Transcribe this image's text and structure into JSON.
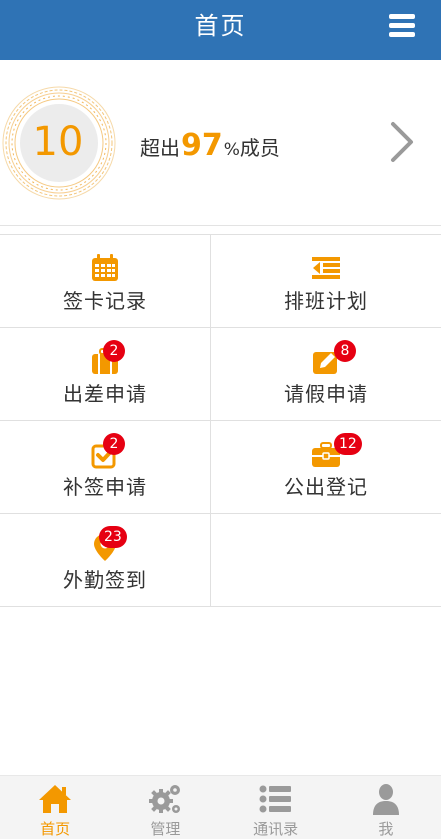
{
  "header": {
    "title": "首页",
    "menu_icon": "hamburger-menu-icon"
  },
  "score": {
    "value": "10",
    "prefix": "超出",
    "percent": "97",
    "unit": "%",
    "suffix": "成员",
    "arrow_icon": "chevron-right-icon"
  },
  "grid": [
    {
      "label": "签卡记录",
      "icon": "calendar-icon",
      "badge": ""
    },
    {
      "label": "排班计划",
      "icon": "schedule-list-icon",
      "badge": ""
    },
    {
      "label": "出差申请",
      "icon": "suitcase-icon",
      "badge": "2"
    },
    {
      "label": "请假申请",
      "icon": "edit-pencil-icon",
      "badge": "8"
    },
    {
      "label": "补签申请",
      "icon": "checkbox-icon",
      "badge": "2"
    },
    {
      "label": "公出登记",
      "icon": "briefcase-icon",
      "badge": "12"
    },
    {
      "label": "外勤签到",
      "icon": "location-pin-icon",
      "badge": "23"
    }
  ],
  "nav": [
    {
      "label": "首页",
      "icon": "home-icon",
      "active": true
    },
    {
      "label": "管理",
      "icon": "gears-icon",
      "active": false
    },
    {
      "label": "通讯录",
      "icon": "contacts-list-icon",
      "active": false
    },
    {
      "label": "我",
      "icon": "user-icon",
      "active": false
    }
  ],
  "colors": {
    "header": "#2f73b5",
    "accent": "#f39800",
    "badge": "#e60012",
    "nav_inactive": "#9a9a9a"
  }
}
